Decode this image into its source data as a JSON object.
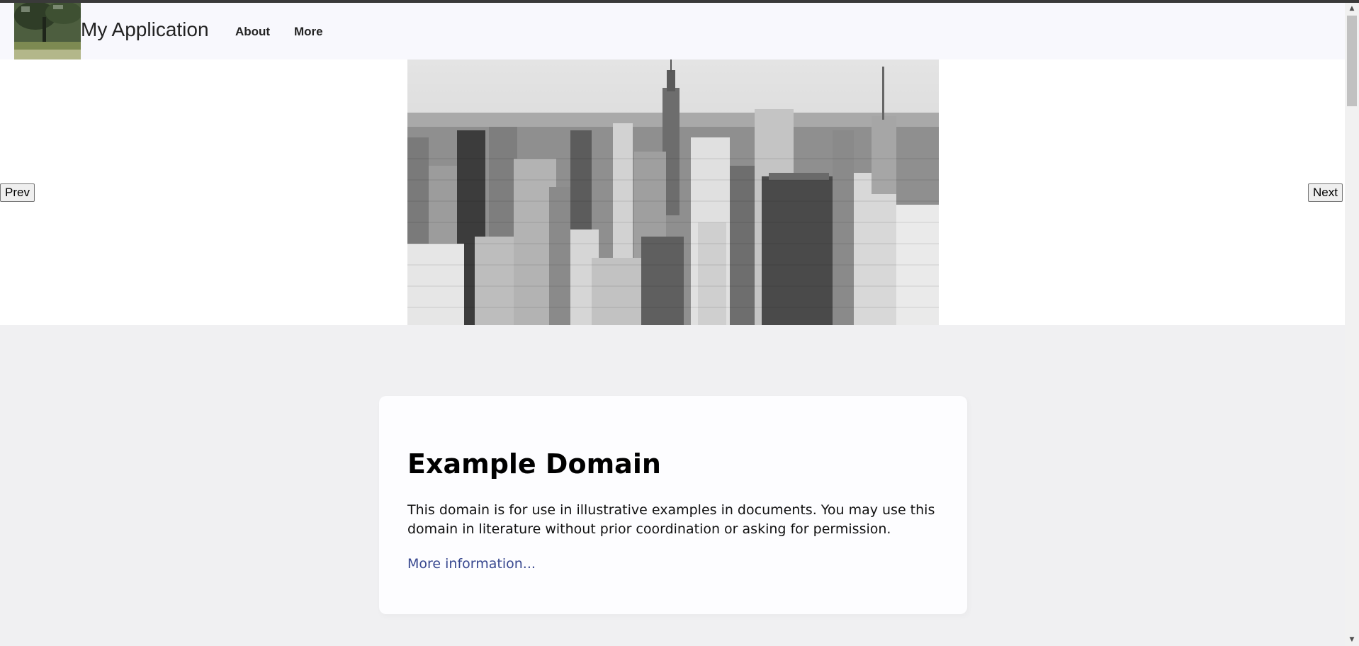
{
  "navbar": {
    "title": "My Application",
    "links": [
      {
        "label": "About"
      },
      {
        "label": "More"
      }
    ],
    "logo_icon": "landscape-thumbnail-icon"
  },
  "carousel": {
    "prev_label": "Prev",
    "next_label": "Next",
    "slide_icon": "city-skyline-photo"
  },
  "card": {
    "heading": "Example Domain",
    "body": "This domain is for use in illustrative examples in documents. You may use this domain in literature without prior coordination or asking for permission.",
    "link_label": "More information..."
  },
  "colors": {
    "page_bg": "#f0f0f2",
    "navbar_bg": "#f8f8fd",
    "card_bg": "#fdfdff",
    "link": "#38488f"
  }
}
